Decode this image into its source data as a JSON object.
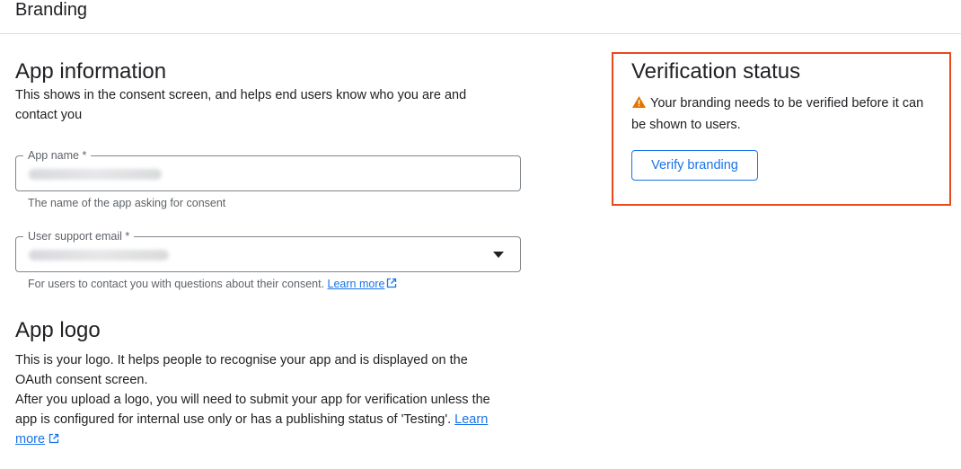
{
  "header": {
    "title": "Branding"
  },
  "app_information": {
    "title": "App information",
    "description_line1": "This shows in the consent screen, and helps end users know who you are and",
    "description_line2": "contact you",
    "app_name": {
      "label": "App name *",
      "hint": "The name of the app asking for consent"
    },
    "support_email": {
      "label": "User support email *",
      "hint": "For users to contact you with questions about their consent.",
      "learn_more": "Learn more"
    }
  },
  "app_logo": {
    "title": "App logo",
    "line1": "This is your logo. It helps people to recognise your app and is displayed on the",
    "line2": "OAuth consent screen.",
    "line3": "After you upload a logo, you will need to submit your app for verification unless the",
    "line4": "app is configured for internal use only or has a publishing status of 'Testing'.",
    "learn_more_part1": "Learn",
    "learn_more_part2": "more"
  },
  "verification": {
    "title": "Verification status",
    "warning_line1": "Your branding needs to be verified before it can",
    "warning_line2": "be shown to users.",
    "button_label": "Verify branding"
  },
  "icons": {
    "warning": "warning-triangle-icon",
    "external": "external-link-icon",
    "dropdown": "arrow-drop-down-icon"
  },
  "colors": {
    "accent": "#1a73e8",
    "highlight_border": "#e8491d",
    "warning": "#e37400"
  }
}
